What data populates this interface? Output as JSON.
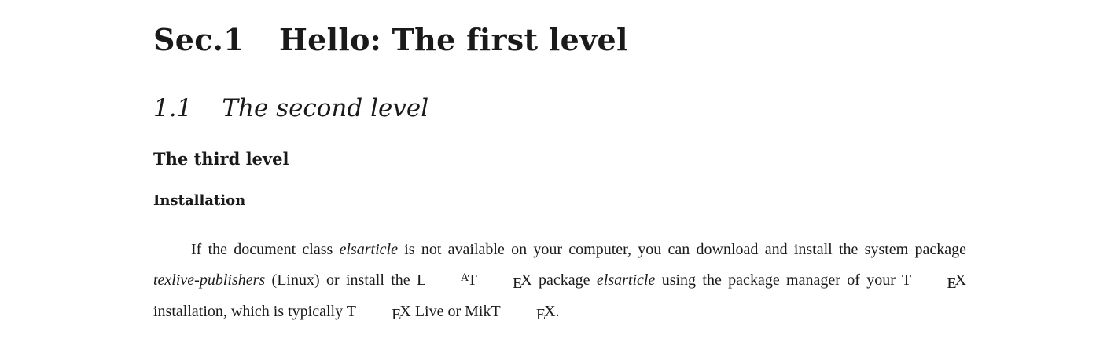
{
  "section": {
    "number": "Sec.1",
    "title": "Hello: The first level"
  },
  "subsection": {
    "number": "1.1",
    "title": "The second level"
  },
  "subsubsection": {
    "title": "The third level"
  },
  "paragraph_heading": {
    "title": "Installation"
  },
  "body": {
    "t1": "If the document class ",
    "i1": "elsarticle",
    "t2": " is not available on your computer, you can download and install the system package ",
    "i2": "texlive-publishers",
    "t3": " (Linux) or install the ",
    "latex_L": "L",
    "latex_A": "A",
    "latex_T": "T",
    "latex_E": "E",
    "latex_X": "X",
    "t4": " package ",
    "i3": "elsarticle",
    "t5": " using the package manager of your ",
    "tex1_T": "T",
    "tex1_E": "E",
    "tex1_X": "X",
    "t6": " installation, which is typically ",
    "tex2_T": "T",
    "tex2_E": "E",
    "tex2_X": "X",
    "t7": " Live or Mik",
    "tex3_T": "T",
    "tex3_E": "E",
    "tex3_X": "X",
    "t8": "."
  }
}
